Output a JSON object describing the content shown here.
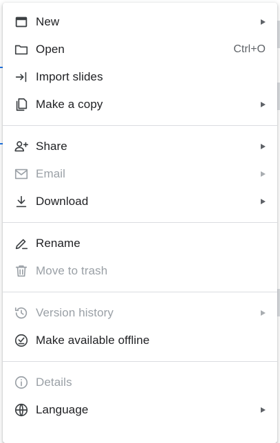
{
  "menu": {
    "sections": [
      [
        {
          "id": "new",
          "label": "New",
          "icon": "new-window-icon",
          "submenu": true,
          "disabled": false
        },
        {
          "id": "open",
          "label": "Open",
          "icon": "folder-icon",
          "shortcut": "Ctrl+O",
          "submenu": false,
          "disabled": false
        },
        {
          "id": "import-slides",
          "label": "Import slides",
          "icon": "import-icon",
          "submenu": false,
          "disabled": false
        },
        {
          "id": "make-a-copy",
          "label": "Make a copy",
          "icon": "copy-icon",
          "submenu": true,
          "disabled": false
        }
      ],
      [
        {
          "id": "share",
          "label": "Share",
          "icon": "person-add-icon",
          "submenu": true,
          "disabled": false
        },
        {
          "id": "email",
          "label": "Email",
          "icon": "mail-icon",
          "submenu": true,
          "disabled": true
        },
        {
          "id": "download",
          "label": "Download",
          "icon": "download-icon",
          "submenu": true,
          "disabled": false
        }
      ],
      [
        {
          "id": "rename",
          "label": "Rename",
          "icon": "rename-icon",
          "submenu": false,
          "disabled": false
        },
        {
          "id": "move-to-trash",
          "label": "Move to trash",
          "icon": "trash-icon",
          "submenu": false,
          "disabled": true
        }
      ],
      [
        {
          "id": "version-history",
          "label": "Version history",
          "icon": "history-icon",
          "submenu": true,
          "disabled": true
        },
        {
          "id": "make-available-offline",
          "label": "Make available offline",
          "icon": "offline-check-icon",
          "submenu": false,
          "disabled": false
        }
      ],
      [
        {
          "id": "details",
          "label": "Details",
          "icon": "info-icon",
          "submenu": false,
          "disabled": true
        },
        {
          "id": "language",
          "label": "Language",
          "icon": "globe-icon",
          "submenu": true,
          "disabled": false
        }
      ]
    ]
  },
  "colors": {
    "text": "#202124",
    "disabled": "#9aa0a6",
    "icon": "#3c4043",
    "divider": "#dadce0"
  }
}
